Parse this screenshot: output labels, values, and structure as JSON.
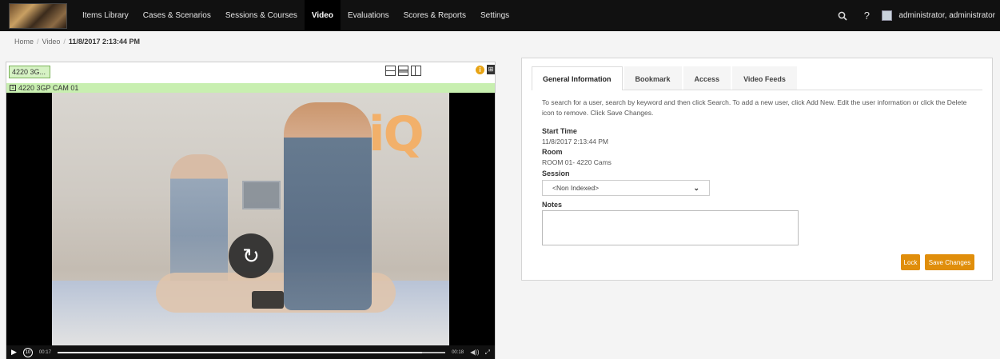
{
  "nav": {
    "items": [
      {
        "label": "Items Library",
        "active": false
      },
      {
        "label": "Cases & Scenarios",
        "active": false
      },
      {
        "label": "Sessions & Courses",
        "active": false
      },
      {
        "label": "Video",
        "active": true
      },
      {
        "label": "Evaluations",
        "active": false
      },
      {
        "label": "Scores & Reports",
        "active": false
      },
      {
        "label": "Settings",
        "active": false
      }
    ],
    "search_icon": "search-icon",
    "help_label": "?",
    "username": "administrator, administrator"
  },
  "breadcrumb": {
    "home": "Home",
    "section": "Video",
    "current": "11/8/2017 2:13:44 PM"
  },
  "video": {
    "camera_select": "4220 3G...",
    "camera_name": "4220 3GP CAM 01",
    "camera_icon_text": "1",
    "logo_text": "iQ",
    "time_current": "00:17",
    "time_total": "00:18",
    "rewind_label": "10",
    "progress": 0.94
  },
  "info": {
    "tabs": [
      "General Information",
      "Bookmark",
      "Access",
      "Video Feeds"
    ],
    "active_tab": 0,
    "description": "To search for a user, search by keyword and then click Search. To add a new user, click Add New. Edit the user information or click the Delete icon to remove. Click Save Changes.",
    "start_time_label": "Start Time",
    "start_time_value": "11/8/2017 2:13:44 PM",
    "room_label": "Room",
    "room_value": "ROOM 01- 4220 Cams",
    "session_label": "Session",
    "session_value": "<Non Indexed>",
    "notes_label": "Notes",
    "lock_label": "Lock",
    "save_label": "Save Changes"
  },
  "colors": {
    "nav_bg": "#111111",
    "camera_bar": "#c8efb0",
    "accent_orange": "#e08e0b",
    "info_icon": "#e8a415"
  }
}
